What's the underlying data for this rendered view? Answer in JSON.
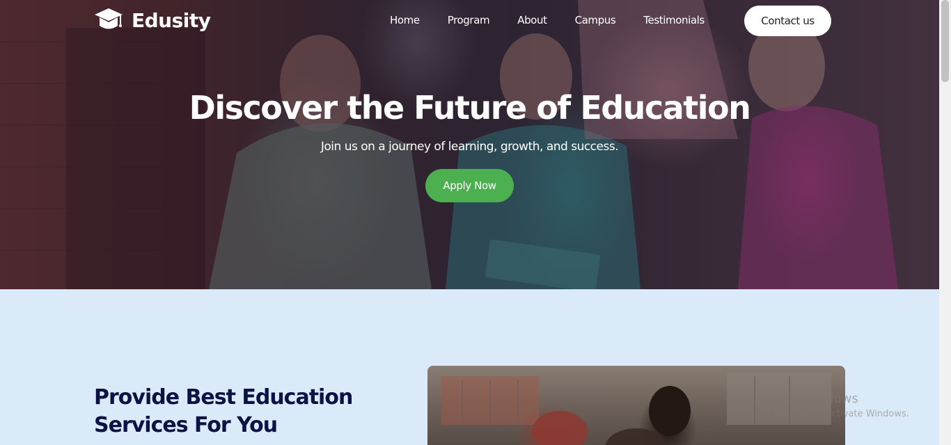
{
  "brand": {
    "name": "Edusity",
    "logo_icon": "graduation-cap-icon"
  },
  "nav": {
    "links": [
      "Home",
      "Program",
      "About",
      "Campus",
      "Testimonials"
    ],
    "contact_label": "Contact us"
  },
  "hero": {
    "title": "Discover the Future of Education",
    "subtitle": "Join us on a journey of learning, growth, and success.",
    "cta_label": "Apply Now"
  },
  "services": {
    "heading_line1": "Provide Best Education",
    "heading_line2": "Services For You"
  },
  "watermark": {
    "title": "Activate Windows",
    "subtitle": "Go to Settings to activate Windows."
  },
  "colors": {
    "hero_overlay": "#08003a",
    "cta_green": "#4caf50",
    "section_bg": "#dbeaf8",
    "heading_navy": "#0c1244",
    "white": "#ffffff"
  }
}
